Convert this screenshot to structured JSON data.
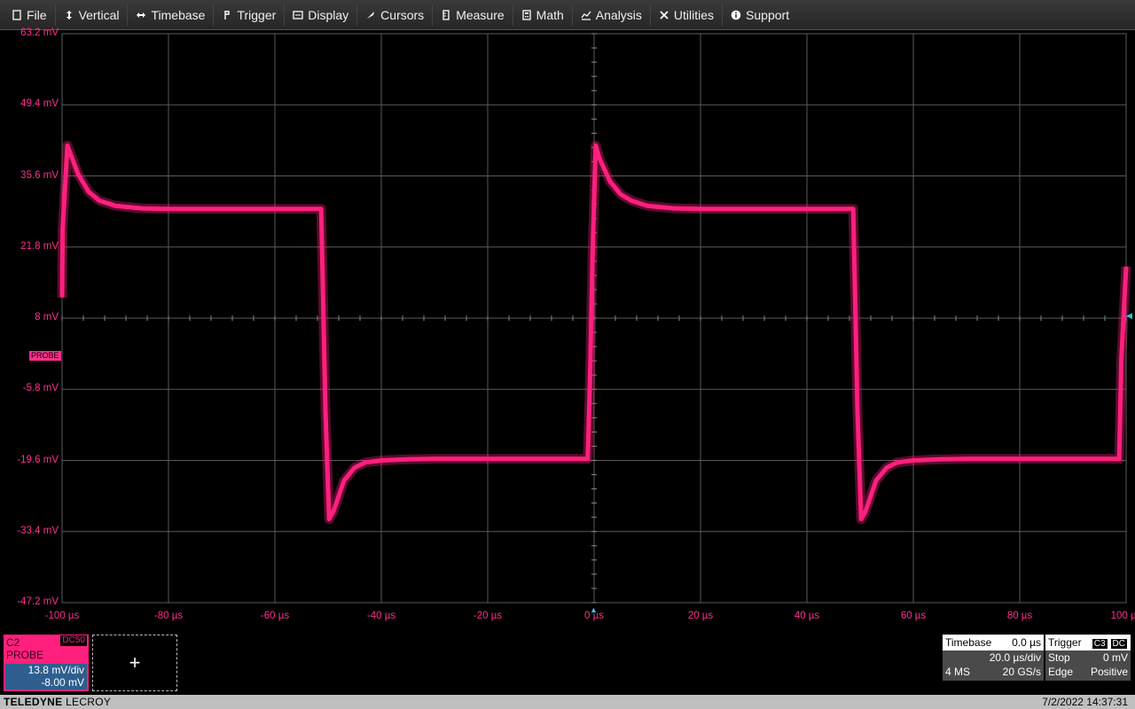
{
  "menu": [
    {
      "label": "File",
      "icon": "file-icon"
    },
    {
      "label": "Vertical",
      "icon": "vertical-arrows-icon"
    },
    {
      "label": "Timebase",
      "icon": "horizontal-arrows-icon"
    },
    {
      "label": "Trigger",
      "icon": "trigger-flag-icon"
    },
    {
      "label": "Display",
      "icon": "display-icon"
    },
    {
      "label": "Cursors",
      "icon": "cursor-icon"
    },
    {
      "label": "Measure",
      "icon": "ruler-icon"
    },
    {
      "label": "Math",
      "icon": "calculator-icon"
    },
    {
      "label": "Analysis",
      "icon": "chart-icon"
    },
    {
      "label": "Utilities",
      "icon": "tools-icon"
    },
    {
      "label": "Support",
      "icon": "info-icon"
    }
  ],
  "colors": {
    "trace": "#ff1f7d",
    "label": "#ff2f8e",
    "grid": "#5a5a5a",
    "trigger_marker": "#2ec4e8"
  },
  "chart_data": {
    "type": "line",
    "x_ticks": [
      "-100 µs",
      "-80 µs",
      "-60 µs",
      "-40 µs",
      "-20 µs",
      "0 µs",
      "20 µs",
      "40 µs",
      "60 µs",
      "80 µs",
      "100 µs"
    ],
    "y_ticks": [
      "63.2 mV",
      "49.4 mV",
      "35.6 mV",
      "21.8 mV",
      "8 mV",
      "-5.8 mV",
      "-19.6 mV",
      "-33.4 mV",
      "-47.2 mV"
    ],
    "xlim": [
      -100,
      100
    ],
    "ylim": [
      -47.2,
      63.2
    ],
    "grid": true,
    "series": [
      {
        "x": [
          -100,
          -99.9,
          -99,
          -97,
          -95,
          -93,
          -90,
          -85,
          -80,
          -70,
          -60,
          -51.3,
          -50.9,
          -50.5,
          -49.8,
          -49,
          -47,
          -45,
          -43,
          -40,
          -35,
          -30,
          -20,
          -10,
          -1.2,
          -0.8,
          -0.3,
          0.3,
          1,
          3,
          5,
          7,
          10,
          15,
          20,
          30,
          40,
          48.7,
          49.1,
          49.5,
          50.2,
          51,
          53,
          55,
          57,
          60,
          65,
          70,
          80,
          90,
          98.7,
          99.1,
          100
        ],
        "y": [
          12,
          25,
          41.5,
          36,
          32.5,
          30.8,
          29.8,
          29.3,
          29.2,
          29.2,
          29.2,
          29.2,
          10,
          -10,
          -31,
          -29.5,
          -23.5,
          -21,
          -20,
          -19.6,
          -19.4,
          -19.3,
          -19.3,
          -19.3,
          -19.3,
          -5,
          20,
          41.5,
          39,
          34.5,
          32,
          30.8,
          29.8,
          29.3,
          29.2,
          29.2,
          29.2,
          29.2,
          10,
          -10,
          -31,
          -29.5,
          -23.5,
          -21,
          -20,
          -19.6,
          -19.4,
          -19.3,
          -19.3,
          -19.3,
          -19.3,
          0,
          18
        ]
      }
    ]
  },
  "markers": {
    "probe_label": "PROBE"
  },
  "channel": {
    "name": "C2",
    "probe": "PROBE",
    "coupling": "DC50",
    "scale": "13.8 mV/div",
    "offset": "-8.00 mV"
  },
  "add_button": "+",
  "timebase": {
    "title": "Timebase",
    "delay": "0.0 µs",
    "scale": "20.0 µs/div",
    "memory": "4 MS",
    "rate": "20 GS/s"
  },
  "trigger": {
    "title": "Trigger",
    "source": "C3",
    "coupling": "DC",
    "mode": "Stop",
    "level": "0 mV",
    "type": "Edge",
    "slope": "Positive"
  },
  "footer": {
    "brand_bold": "TELEDYNE",
    "brand_rest": "LECROY",
    "datetime": "7/2/2022 14:37:31"
  }
}
